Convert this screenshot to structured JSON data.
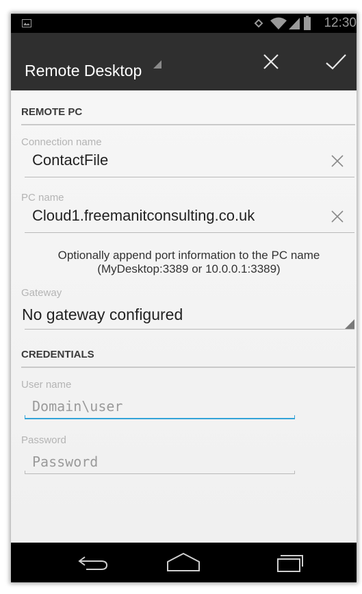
{
  "status_bar": {
    "time": "12:30",
    "icons": [
      "image-icon",
      "rotate-icon",
      "wifi-icon",
      "signal-icon",
      "battery-icon"
    ]
  },
  "action_bar": {
    "title": "Remote Desktop",
    "actions": [
      "close-icon",
      "check-icon"
    ]
  },
  "remote_pc": {
    "header": "REMOTE PC",
    "connection_name": {
      "label": "Connection name",
      "value": "ContactFile"
    },
    "pc_name": {
      "label": "PC name",
      "value": "Cloud1.freemanitconsulting.co.uk"
    },
    "hint_line1": "Optionally append port information to the PC name",
    "hint_line2": "(MyDesktop:3389 or 10.0.0.1:3389)",
    "gateway": {
      "label": "Gateway",
      "value": "No gateway configured"
    }
  },
  "credentials": {
    "header": "CREDENTIALS",
    "user_name": {
      "label": "User name",
      "placeholder": "Domain\\user",
      "value": ""
    },
    "password": {
      "label": "Password",
      "placeholder": "Password",
      "value": ""
    }
  },
  "nav_bar": {
    "buttons": [
      "back-icon",
      "home-icon",
      "recent-apps-icon"
    ]
  },
  "colors": {
    "status_bar": "#000000",
    "action_bar": "#2f2f2f",
    "focus_underline": "#33a3d8",
    "divider": "#c9c9c9",
    "label": "#b4b4b4"
  }
}
